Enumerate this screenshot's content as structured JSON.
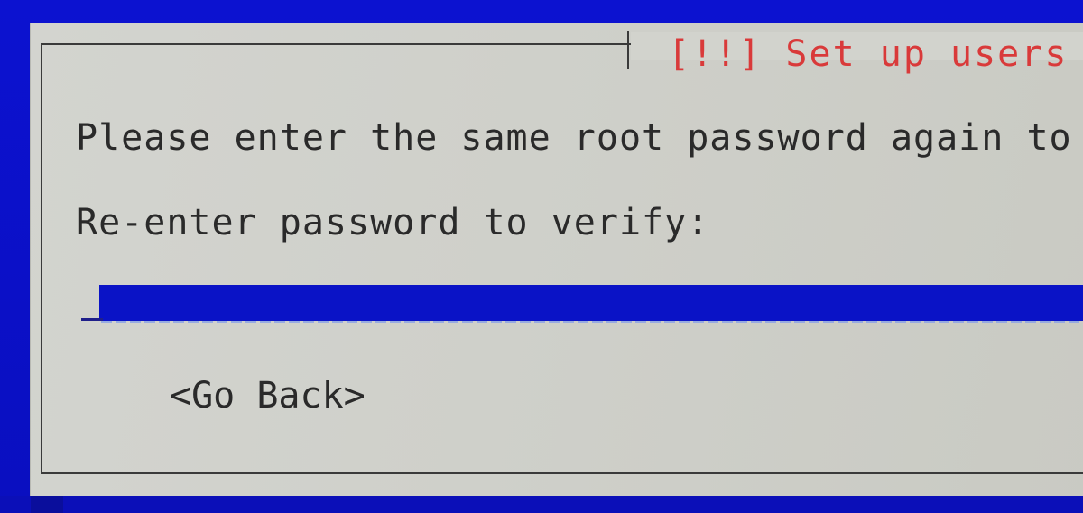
{
  "dialog": {
    "title": "[!!] Set up users an",
    "prompt": "Please enter the same root password again to ve",
    "field_label": "Re-enter password to verify:",
    "password_value": "",
    "go_back_label": "<Go Back>"
  },
  "colors": {
    "background": "#0a10c8",
    "dialog": "#d3d4cf",
    "title": "#d93a3a",
    "input": "#0a13c6",
    "text": "#2a2a2a"
  }
}
